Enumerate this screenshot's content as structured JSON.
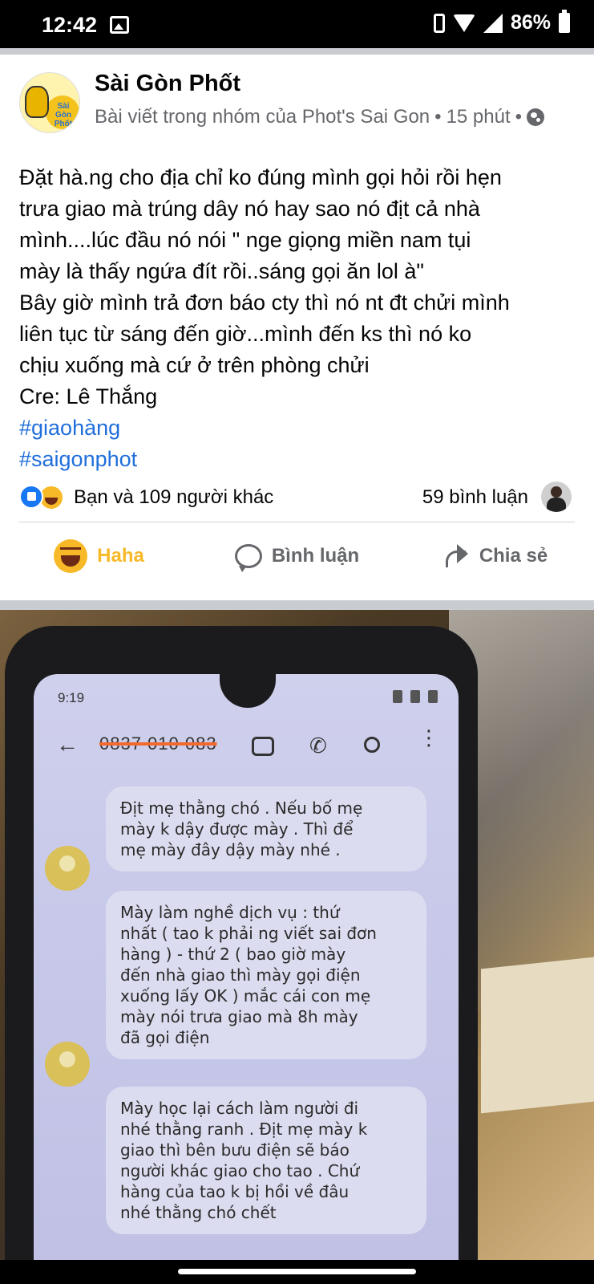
{
  "status_bar": {
    "time": "12:42",
    "battery_percent": "86%",
    "icons": [
      "gallery-icon",
      "phone-icon",
      "wifi-icon",
      "signal-icon",
      "battery-icon"
    ]
  },
  "post": {
    "page_name": "Sài Gòn Phốt",
    "subtitle": "Bài viết trong nhóm của Phot's Sai Gon",
    "time": "15 phút",
    "separator": "•",
    "body_lines": [
      "Đặt hà.ng cho địa chỉ ko đúng mình gọi hỏi rồi hẹn",
      "trưa giao mà trúng dây nó hay sao nó địt cả nhà",
      "mình....lúc đầu nó nói \" nge giọng miền nam tụi",
      "mày là thấy ngứa đít rồi..sáng gọi ăn lol à\"",
      "Bây giờ mình trả đơn báo cty thì nó nt đt chửi mình",
      "liên tục từ sáng đến giờ...mình đến ks thì nó ko",
      "chịu xuống mà cứ ở trên phòng chửi",
      "Cre: Lê Thắng"
    ],
    "hashtags": [
      "#giaohàng",
      "#saigonphot"
    ],
    "reactions_text": "Bạn và 109 người khác",
    "comments_text": "59 bình luận",
    "actions": {
      "haha": "Haha",
      "comment": "Bình luận",
      "share": "Chia sẻ"
    },
    "colors": {
      "hashtag": "#216fdb",
      "haha_active": "#f7b928",
      "like": "#1877f2"
    }
  },
  "photo": {
    "inner_time": "9:19",
    "inner_number": "0837 010 083",
    "messages": [
      {
        "lines": [
          "Địt mẹ thằng chó . Nếu bố mẹ",
          "mày k dậy được mày . Thì để",
          "mẹ mày đây dậy mày nhé ."
        ]
      },
      {
        "lines": [
          "Mày làm nghề dịch vụ : thứ",
          "nhất ( tao k phải ng viết sai đơn",
          "hàng ) - thứ 2 ( bao giờ mày",
          "đến nhà giao thì mày gọi điện",
          "xuống lấy OK ) mắc cái con mẹ",
          "mày nói trưa giao mà 8h mày",
          "đã gọi điện"
        ]
      },
      {
        "lines": [
          "Mày học lại cách làm người đi",
          "nhé thằng ranh . Địt mẹ mày k",
          "giao thì bên bưu điện sẽ báo",
          "người khác giao cho tao . Chứ",
          "hàng của tao k bị hồi về đâu",
          "nhé thằng chó chết"
        ]
      }
    ]
  }
}
